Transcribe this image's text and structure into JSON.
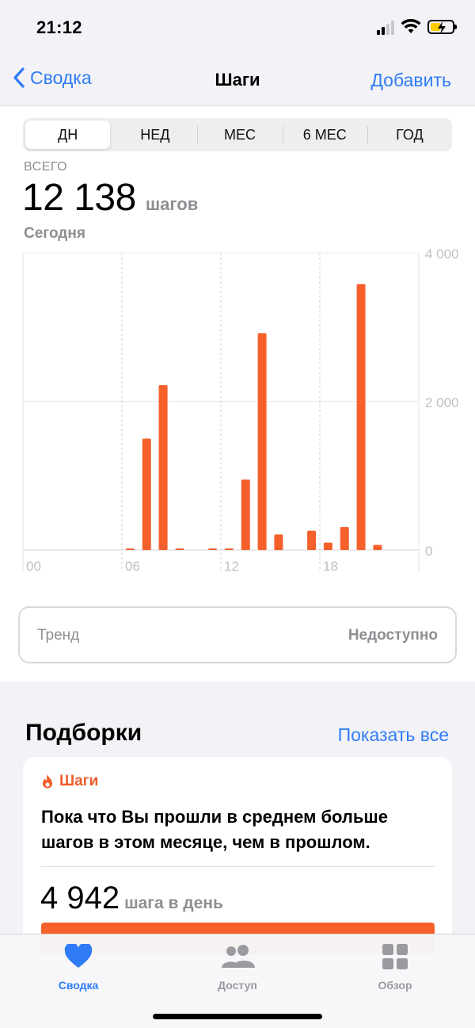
{
  "status": {
    "time": "21:12"
  },
  "nav": {
    "back_label": "Сводка",
    "title": "Шаги",
    "action_label": "Добавить"
  },
  "segments": [
    {
      "label": "ДН",
      "active": true
    },
    {
      "label": "НЕД",
      "active": false
    },
    {
      "label": "МЕС",
      "active": false
    },
    {
      "label": "6 МЕС",
      "active": false
    },
    {
      "label": "ГОД",
      "active": false
    }
  ],
  "summary": {
    "label": "ВСЕГО",
    "value": "12 138",
    "unit": "шагов",
    "period": "Сегодня"
  },
  "chart_data": {
    "type": "bar",
    "x_tick_labels": [
      "00",
      "06",
      "12",
      "18"
    ],
    "y_tick_labels": [
      "0",
      "2 000",
      "4 000"
    ],
    "ylim": [
      0,
      4000
    ],
    "grid": true,
    "bar_color": "#f5602b",
    "hours": [
      0,
      1,
      2,
      3,
      4,
      5,
      6,
      7,
      8,
      9,
      10,
      11,
      12,
      13,
      14,
      15,
      16,
      17,
      18,
      19,
      20,
      21,
      22,
      23
    ],
    "values": [
      0,
      0,
      0,
      0,
      0,
      0,
      20,
      1500,
      2220,
      15,
      0,
      15,
      10,
      950,
      2920,
      210,
      0,
      260,
      100,
      310,
      3580,
      70,
      0,
      0
    ]
  },
  "trend": {
    "label": "Тренд",
    "value": "Недоступно"
  },
  "highlights": {
    "title": "Подборки",
    "show_all": "Показать все",
    "card": {
      "category": "Шаги",
      "text": "Пока что Вы прошли в среднем больше шагов в этом месяце, чем в прошлом.",
      "value": "4 942",
      "unit": "шага в день"
    }
  },
  "tabbar": [
    {
      "label": "Сводка",
      "icon": "heart-icon",
      "active": true
    },
    {
      "label": "Доступ",
      "icon": "people-icon",
      "active": false
    },
    {
      "label": "Обзор",
      "icon": "grid-icon",
      "active": false
    }
  ],
  "colors": {
    "accent": "#2f7cf6",
    "bar": "#f5602b"
  }
}
